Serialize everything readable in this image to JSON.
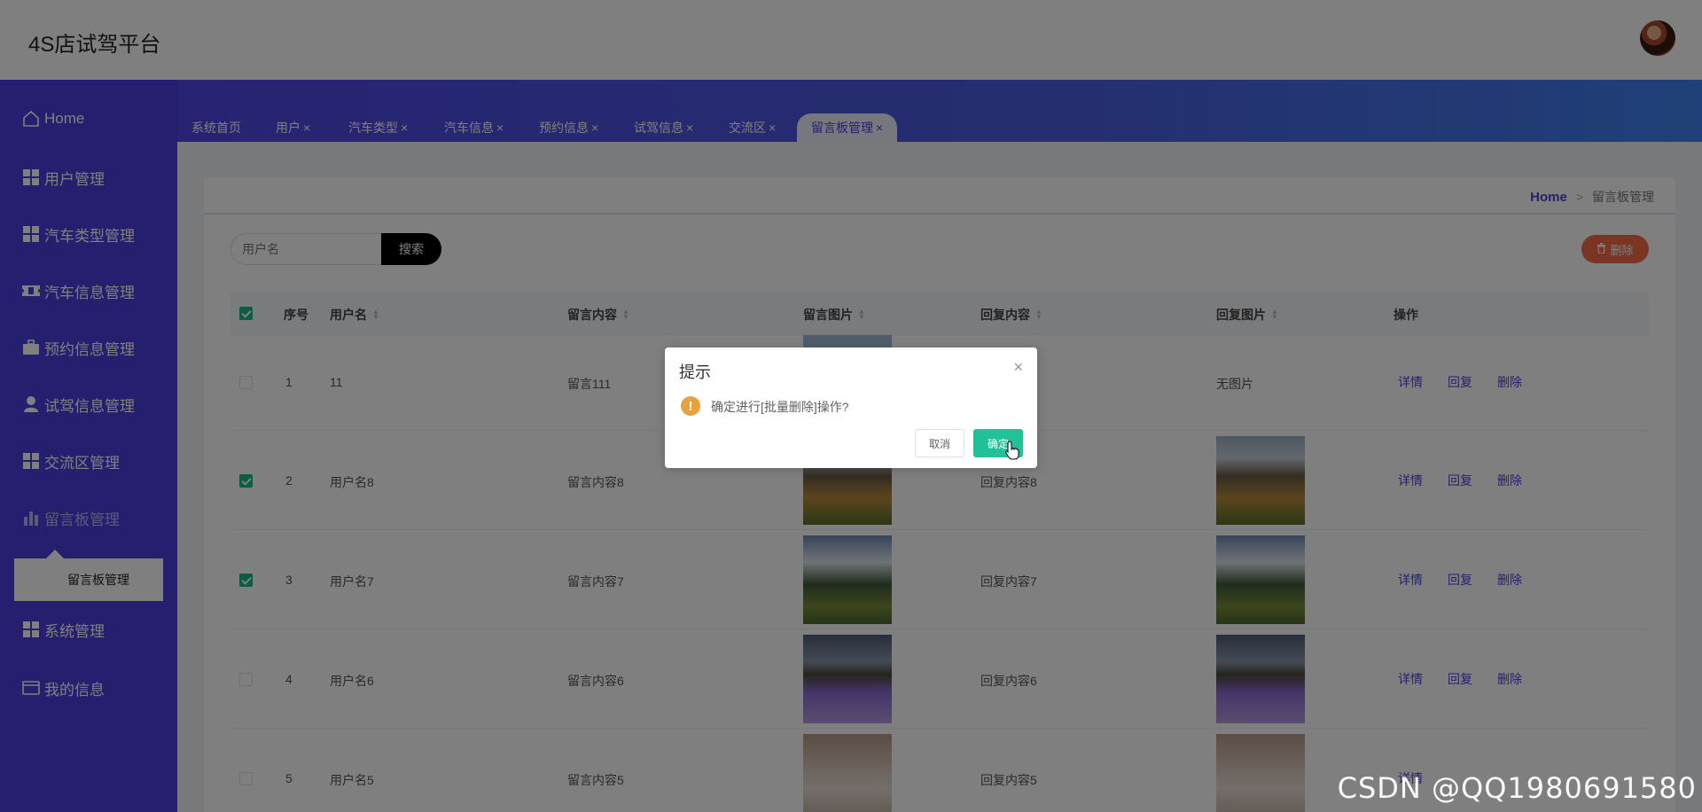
{
  "app": {
    "title": "4S店试驾平台"
  },
  "sidebar": {
    "items": [
      {
        "label": "Home",
        "icon": "home-icon"
      },
      {
        "label": "用户管理",
        "icon": "grid-icon"
      },
      {
        "label": "汽车类型管理",
        "icon": "grid-icon"
      },
      {
        "label": "汽车信息管理",
        "icon": "ticket-icon"
      },
      {
        "label": "预约信息管理",
        "icon": "briefcase-icon"
      },
      {
        "label": "试驾信息管理",
        "icon": "user-icon"
      },
      {
        "label": "交流区管理",
        "icon": "grid-icon"
      },
      {
        "label": "留言板管理",
        "icon": "bar-chart-icon"
      },
      {
        "label": "系统管理",
        "icon": "grid-icon"
      },
      {
        "label": "我的信息",
        "icon": "card-icon"
      }
    ],
    "submenu": "留言板管理"
  },
  "tabs": [
    {
      "label": "系统首页",
      "closable": false
    },
    {
      "label": "用户",
      "closable": true
    },
    {
      "label": "汽车类型",
      "closable": true
    },
    {
      "label": "汽车信息",
      "closable": true
    },
    {
      "label": "预约信息",
      "closable": true
    },
    {
      "label": "试驾信息",
      "closable": true
    },
    {
      "label": "交流区",
      "closable": true
    },
    {
      "label": "留言板管理",
      "closable": true,
      "active": true
    }
  ],
  "tab_close_glyph": "×",
  "breadcrumb": {
    "home": "Home",
    "sep": ">",
    "current": "留言板管理"
  },
  "toolbar": {
    "search_placeholder": "用户名",
    "search_label": "搜索",
    "delete_label": "删除"
  },
  "table": {
    "columns": [
      "序号",
      "用户名",
      "留言内容",
      "留言图片",
      "回复内容",
      "回复图片",
      "操作"
    ],
    "actions": [
      "详情",
      "回复",
      "删除"
    ],
    "rows": [
      {
        "index": "1",
        "username": "11",
        "content": "留言111",
        "reply": "",
        "reply_image_text": "无图片",
        "checked": false
      },
      {
        "index": "2",
        "username": "用户名8",
        "content": "留言内容8",
        "reply": "回复内容8",
        "checked": true
      },
      {
        "index": "3",
        "username": "用户名7",
        "content": "留言内容7",
        "reply": "回复内容7",
        "checked": true
      },
      {
        "index": "4",
        "username": "用户名6",
        "content": "留言内容6",
        "reply": "回复内容6",
        "checked": false
      },
      {
        "index": "5",
        "username": "用户名5",
        "content": "留言内容5",
        "reply": "回复内容5",
        "checked": false
      }
    ]
  },
  "dialog": {
    "title": "提示",
    "message": "确定进行[批量删除]操作?",
    "cancel": "取消",
    "confirm": "确定",
    "warn_glyph": "!",
    "close_glyph": "×"
  },
  "watermark": "CSDN @QQ1980691580",
  "colors": {
    "primary": "#4d3fe0",
    "confirm": "#21c29a",
    "danger": "#f56c47",
    "warning": "#e6a23c"
  }
}
